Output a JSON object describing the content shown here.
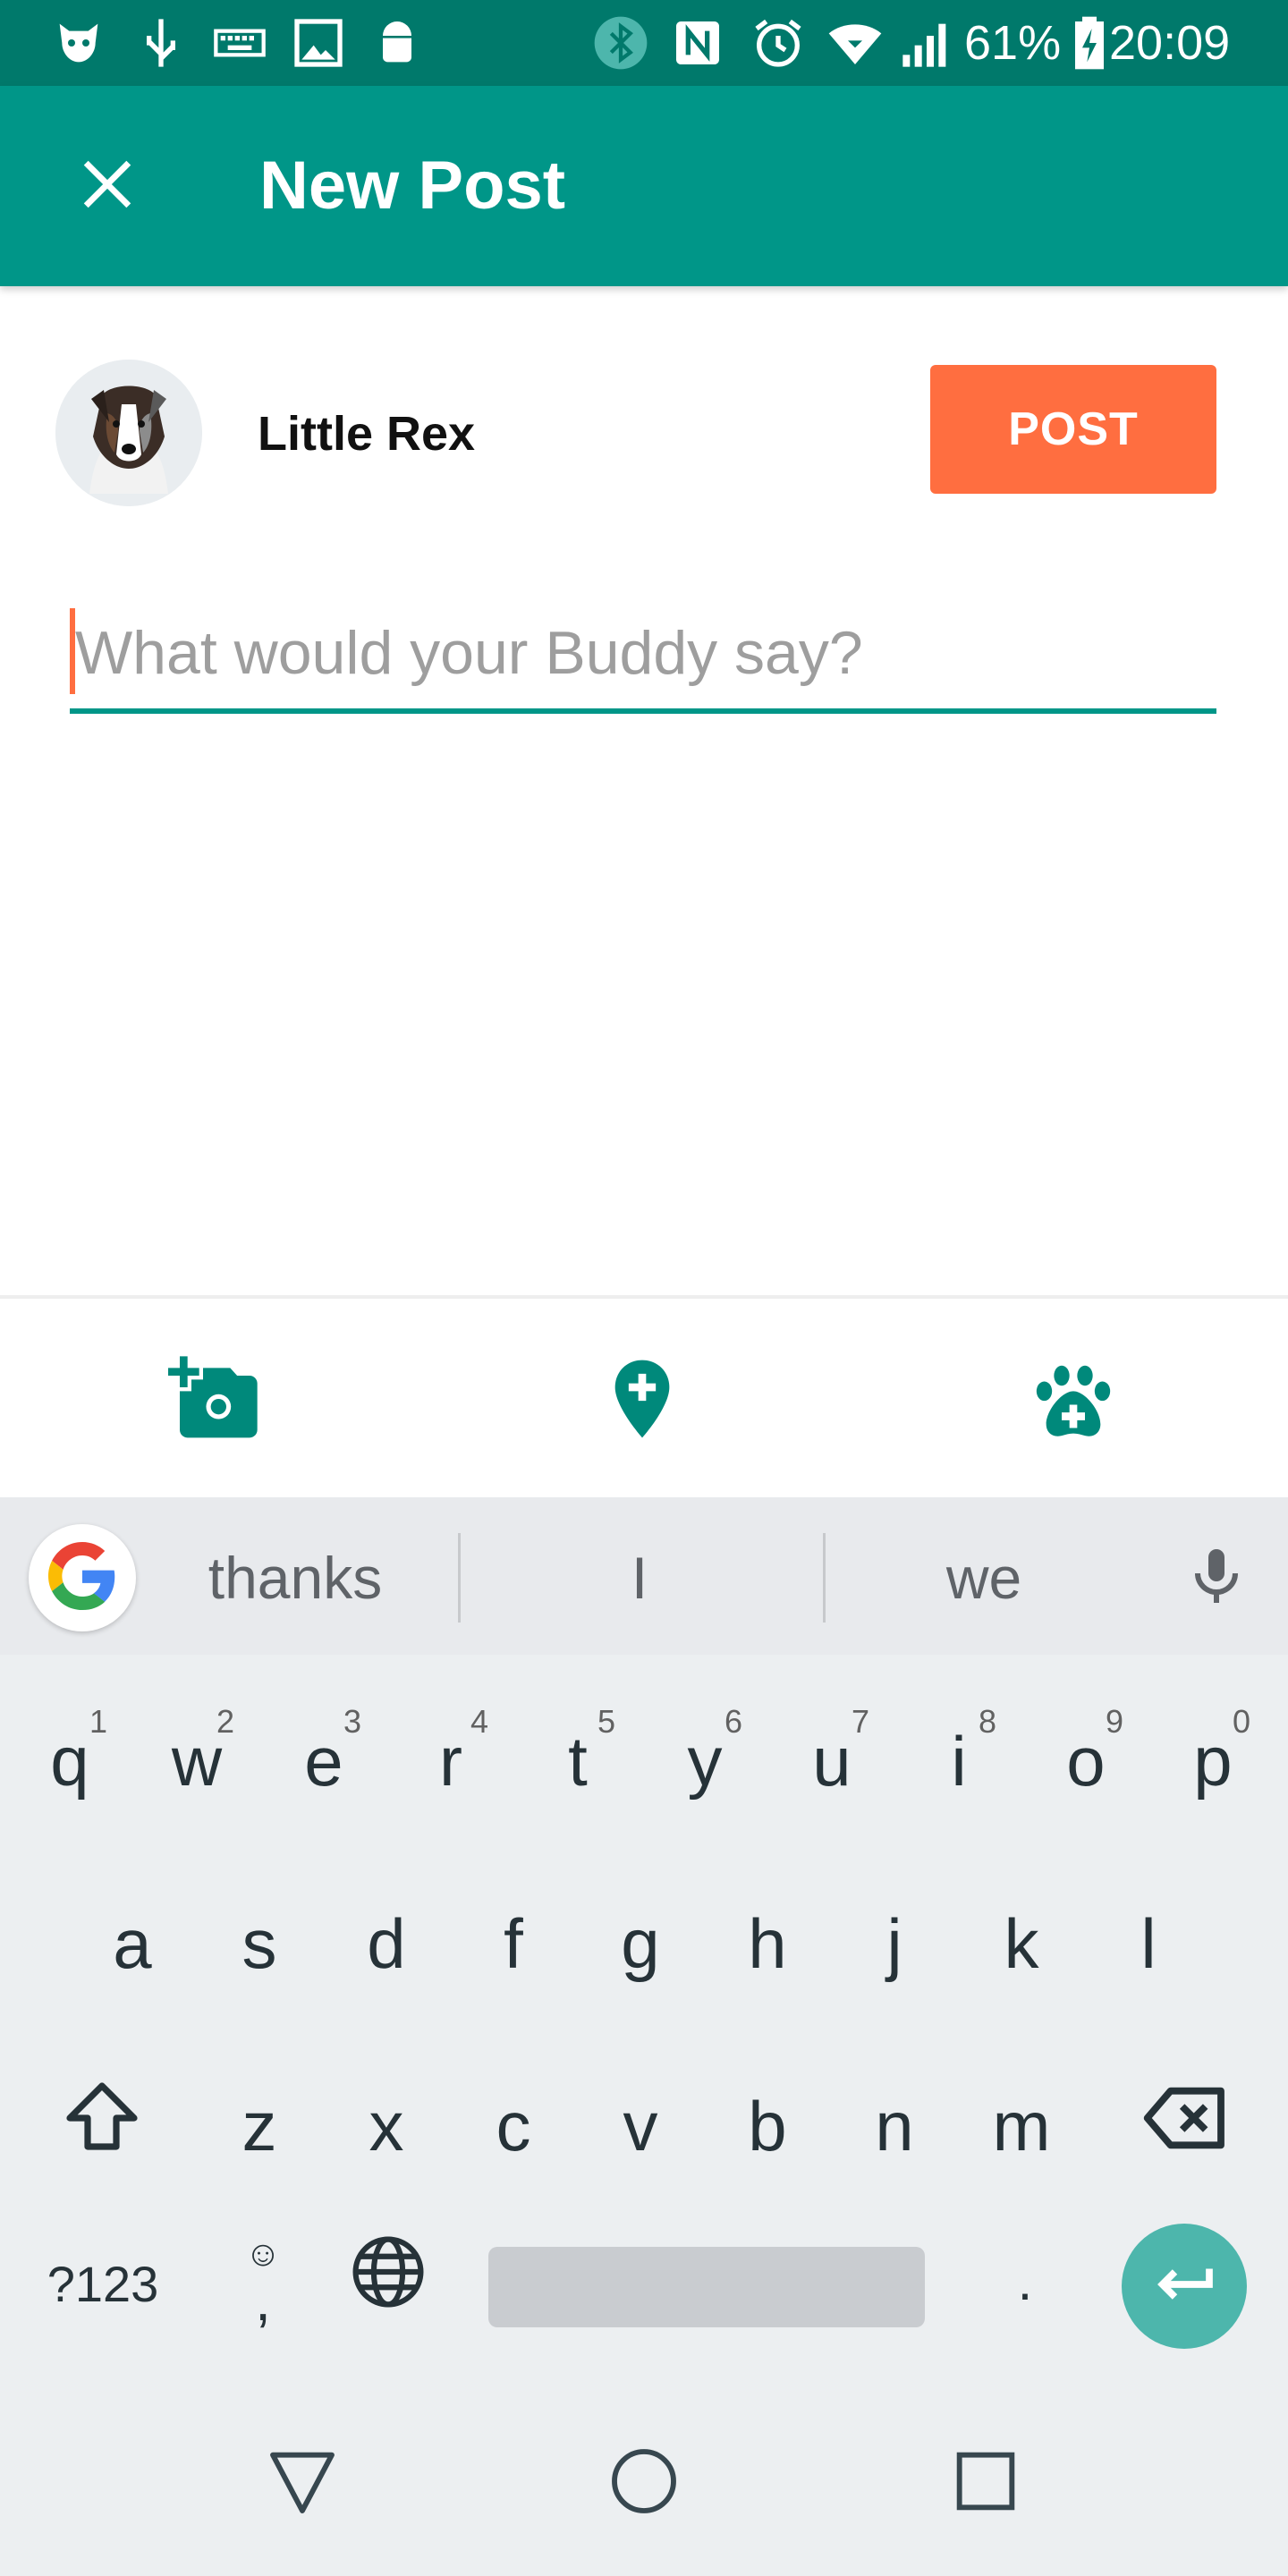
{
  "status_bar": {
    "battery": "61%",
    "time": "20:09",
    "icons": [
      "app-notification-icon",
      "usb-icon",
      "keyboard-icon",
      "image-icon",
      "android-icon",
      "bluetooth-icon",
      "nfc-icon",
      "alarm-icon",
      "wifi-icon",
      "signal-icon",
      "battery-icon"
    ]
  },
  "app_bar": {
    "title": "New Post",
    "close_icon": "close-icon",
    "color": "#009688"
  },
  "composer": {
    "username": "Little Rex",
    "post_label": "POST",
    "placeholder": "What would your Buddy say?",
    "value": "",
    "accent": "#ff6e40"
  },
  "attachments": {
    "icons": [
      "add-photo-icon",
      "add-location-icon",
      "add-pet-icon"
    ]
  },
  "keyboard": {
    "suggestions": [
      "thanks",
      "I",
      "we"
    ],
    "row1": [
      "q",
      "w",
      "e",
      "r",
      "t",
      "y",
      "u",
      "i",
      "o",
      "p"
    ],
    "row1_hints": [
      "1",
      "2",
      "3",
      "4",
      "5",
      "6",
      "7",
      "8",
      "9",
      "0"
    ],
    "row2": [
      "a",
      "s",
      "d",
      "f",
      "g",
      "h",
      "j",
      "k",
      "l"
    ],
    "row3": [
      "z",
      "x",
      "c",
      "v",
      "b",
      "n",
      "m"
    ],
    "symbols_label": "?123",
    "comma_label": ",",
    "period_label": "."
  },
  "nav_bar": {
    "icons": [
      "back-icon",
      "home-icon",
      "recents-icon"
    ]
  }
}
